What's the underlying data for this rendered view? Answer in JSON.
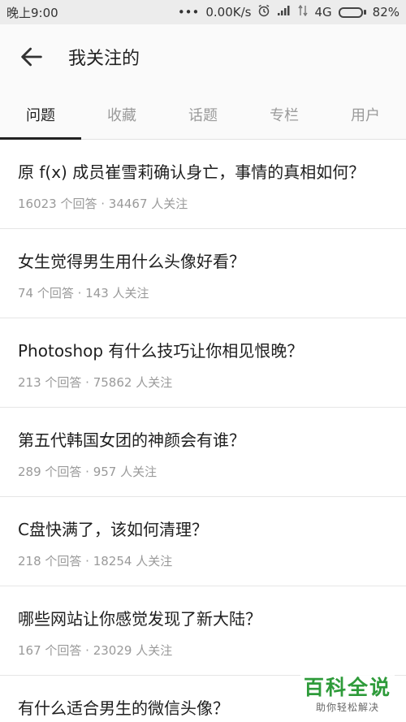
{
  "status_bar": {
    "time": "晚上9:00",
    "net_speed": "0.00K/s",
    "network": "4G",
    "battery_text": "82%",
    "battery_level": 0.82
  },
  "header": {
    "title": "我关注的"
  },
  "tabs": [
    {
      "label": "问题",
      "active": true
    },
    {
      "label": "收藏",
      "active": false
    },
    {
      "label": "话题",
      "active": false
    },
    {
      "label": "专栏",
      "active": false
    },
    {
      "label": "用户",
      "active": false
    }
  ],
  "questions": [
    {
      "title": "原 f(x) 成员崔雪莉确认身亡，事情的真相如何？",
      "meta": "16023 个回答 · 34467 人关注"
    },
    {
      "title": "女生觉得男生用什么头像好看？",
      "meta": "74 个回答 · 143 人关注"
    },
    {
      "title": "Photoshop 有什么技巧让你相见恨晚？",
      "meta": "213 个回答 · 75862 人关注"
    },
    {
      "title": "第五代韩国女团的神颜会有谁？",
      "meta": "289 个回答 · 957 人关注"
    },
    {
      "title": "C盘快满了，该如何清理？",
      "meta": "218 个回答 · 18254 人关注"
    },
    {
      "title": "哪些网站让你感觉发现了新大陆？",
      "meta": "167 个回答 · 23029 人关注"
    },
    {
      "title": "有什么适合男生的微信头像？",
      "meta": ""
    }
  ],
  "watermark": {
    "title": "百科全说",
    "subtitle": "助你轻松解决"
  },
  "colors": {
    "accent": "#222222",
    "watermark_green": "#2e9b3a"
  }
}
